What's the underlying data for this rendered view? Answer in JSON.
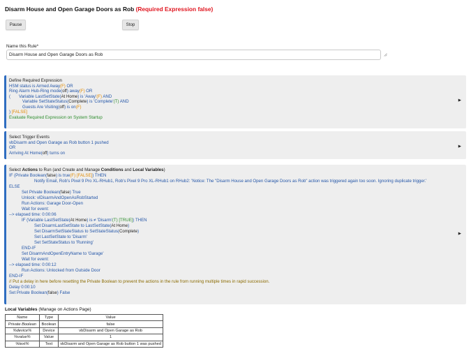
{
  "header": {
    "title": "Disarm House and Open Garage Doors as Rob",
    "status": "(Required Expression false)"
  },
  "buttons": {
    "pause": "Pause",
    "stop": "Stop"
  },
  "name_field": {
    "label": "Name this Rule*",
    "value": "Disarm House and Open Garage Doors as Rob"
  },
  "required_expression": {
    "title": "Define Required Expression",
    "l1a": "HSM status is Armed Away",
    "l1b": "(F)",
    "l1c": "  OR",
    "l2a": "Ring Alarm Hub-Ring mode(",
    "l2b": "off",
    "l2c": ") away",
    "l2d": "(F)",
    "l2e": "  OR",
    "l3a": "(",
    "l3b": "Variable LastSetState(",
    "l3c": "At Home",
    "l3d": ") is 'Away'",
    "l3e": "(F)",
    "l3f": "  AND",
    "l4a": "Variable SetStateStatus(",
    "l4b": "Complete",
    "l4c": ") is 'Complete'",
    "l4d": "(T)",
    "l4e": "  AND",
    "l5a": "Guests Are Visiting(",
    "l5b": "off",
    "l5c": ") is on",
    "l5d": "(F)",
    "l6a": ")",
    "l6b": " [FALSE]",
    "l7": "Evaluate Required Expression on System Startup"
  },
  "triggers": {
    "title": "Select Trigger Events",
    "l1": "vbDisarm and Open Garage as Rob button 1 pushed",
    "l2": "OR",
    "l3a": "Arriving At Home(",
    "l3b": "off",
    "l3c": ") turns on"
  },
  "actions": {
    "t1": "Select ",
    "t2": "Actions",
    "t3": " to Run (and Create and Manage ",
    "t4": "Conditions",
    "t5": " and ",
    "t6": "Local Variables",
    "t7": ")",
    "l1a": "IF (Private Boolean(",
    "l1b": "false",
    "l1c": ") is true",
    "l1d": "(F)",
    "l1e": " [FALSE]",
    "l1f": ") THEN",
    "l2": "Notify Email, Rob's Pixel 9 Pro XL-RHub1, Rob's Pixel 9 Pro XL-RHub1 on RHub2: 'Notice: The \"Disarm House and Open Garage Doors as Rob\" action was triggered again too soon. Ignoring duplicate trigger.'",
    "l3": "ELSE",
    "l4a": "Set Private Boolean(",
    "l4b": "false",
    "l4c": ") True",
    "l5": "Unlock: vlDisarmAndOpenAsRobStarted",
    "l6": "Run Actions: Garage Door-Open",
    "l7": "Wait for event:",
    "l8": "--> elapsed time: 0:00:06",
    "l9a": "IF (Variable LastSetState(",
    "l9b": "At Home",
    "l9c": ") is ≠ 'Disarm'",
    "l9d": "(T)",
    "l9e": " [TRUE]",
    "l9f": ") THEN",
    "l10a": "Set DisarmLastSetState to LastSetState(",
    "l10b": "At Home",
    "l10c": ")",
    "l11a": "Set DisarmSetStateStatus to SetStateStatus(",
    "l11b": "Complete",
    "l11c": ")",
    "l12": "Set LastSetState to 'Disarm'",
    "l13": "Set SetStateStatus to 'Running'",
    "l14": "END-IF",
    "l15": "Set DisarmAndOpenEntryName to 'Garage'",
    "l16": "Wait for event:",
    "l17": "--> elapsed time: 0:00:12",
    "l18": "Run Actions: Unlocked from Outside Door",
    "l19": "END-IF",
    "l20": "// Put a delay in here before resetting the Private Boolean to prevent the actions in the rule from running multiple times in rapid succession.",
    "l21": "Delay 0:00:10",
    "l22a": "Set Private Boolean(",
    "l22b": "false",
    "l22c": ") False"
  },
  "local_variables": {
    "title": "Local Variables",
    "subtitle": " (Manage on Actions Page)",
    "headers": [
      "Name",
      "Type",
      "Value"
    ],
    "rows": [
      [
        "Private Boolean",
        "Boolean",
        "false"
      ],
      [
        "%device%",
        "Device",
        "vbDisarm and Open Garage as Rob"
      ],
      [
        "%value%",
        "Value",
        "1"
      ],
      [
        "%text%",
        "Text",
        "vbDisarm and Open Garage as Rob button 1 was pushed"
      ]
    ]
  },
  "colors": {
    "accent_bar": "#2f6dc1",
    "condition_blue": "#2456a8",
    "false_orange": "#e08a00",
    "true_green": "#2c8c2c",
    "error_red": "#e0141e",
    "comment_olive": "#8a6a00"
  },
  "icons": {
    "section_expand": "triangle-right-icon",
    "textarea_resize": "resize-grip-icon"
  }
}
